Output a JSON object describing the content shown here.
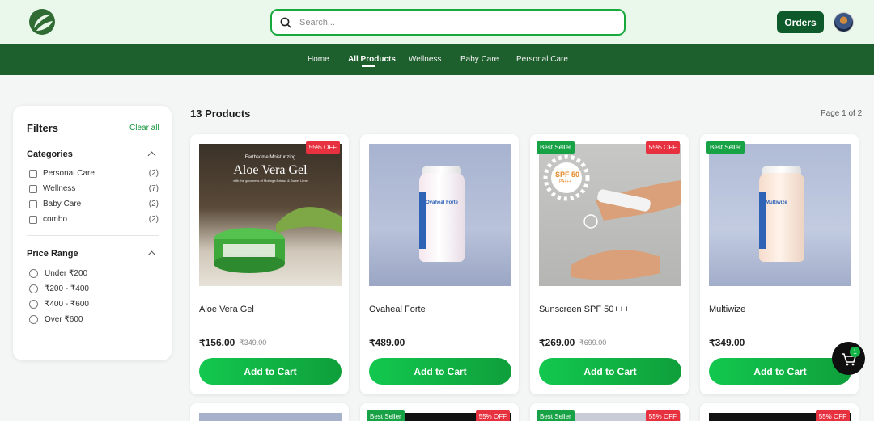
{
  "header": {
    "search_placeholder": "Search...",
    "orders_label": "Orders"
  },
  "nav": {
    "items": [
      {
        "label": "Home"
      },
      {
        "label": "All Products"
      },
      {
        "label": "Wellness"
      },
      {
        "label": "Baby Care"
      },
      {
        "label": "Personal Care"
      }
    ],
    "active": "All Products"
  },
  "filters": {
    "title": "Filters",
    "clear_label": "Clear all",
    "categories_title": "Categories",
    "categories": [
      {
        "label": "Personal Care",
        "count": "(2)"
      },
      {
        "label": "Wellness",
        "count": "(7)"
      },
      {
        "label": "Baby Care",
        "count": "(2)"
      },
      {
        "label": "combo",
        "count": "(2)"
      }
    ],
    "price_title": "Price Range",
    "price_ranges": [
      {
        "label": "Under ₹200"
      },
      {
        "label": "₹200 - ₹400"
      },
      {
        "label": "₹400 - ₹600"
      },
      {
        "label": "Over ₹600"
      }
    ]
  },
  "products_header": {
    "count_label": "13 Products",
    "page_label": "Page 1 of 2"
  },
  "products": [
    {
      "name": "Aloe Vera Gel",
      "price": "₹156.00",
      "old_price": "₹349.00",
      "discount": "55% OFF",
      "best_seller": "",
      "image_title": "Aloe Vera Gel",
      "image_brand": "Earthsome Moisturizing",
      "image_sub": "with the goodness of Moringa Extract & Sweet Lime"
    },
    {
      "name": "Ovaheal Forte",
      "price": "₹489.00",
      "old_price": "",
      "discount": "",
      "best_seller": "",
      "image_title": "Ovaheal Forte"
    },
    {
      "name": "Sunscreen SPF 50+++",
      "price": "₹269.00",
      "old_price": "₹699.00",
      "discount": "55% OFF",
      "best_seller": "Best Seller",
      "image_title": "SPF 50",
      "image_sub": "PA+++"
    },
    {
      "name": "Multiwize",
      "price": "₹349.00",
      "old_price": "",
      "discount": "",
      "best_seller": "Best Seller",
      "image_title": "Multiwize"
    }
  ],
  "row2_badges": [
    {
      "best_seller": "",
      "discount": ""
    },
    {
      "best_seller": "Best Seller",
      "discount": "55% OFF"
    },
    {
      "best_seller": "Best Seller",
      "discount": "55% OFF"
    },
    {
      "best_seller": "",
      "discount": "55% OFF"
    }
  ],
  "add_to_cart_label": "Add to Cart",
  "cart": {
    "count": "1"
  },
  "colors": {
    "brand_green": "#1e5f2e",
    "accent_green": "#12c84e",
    "discount_red": "#e8313f"
  }
}
